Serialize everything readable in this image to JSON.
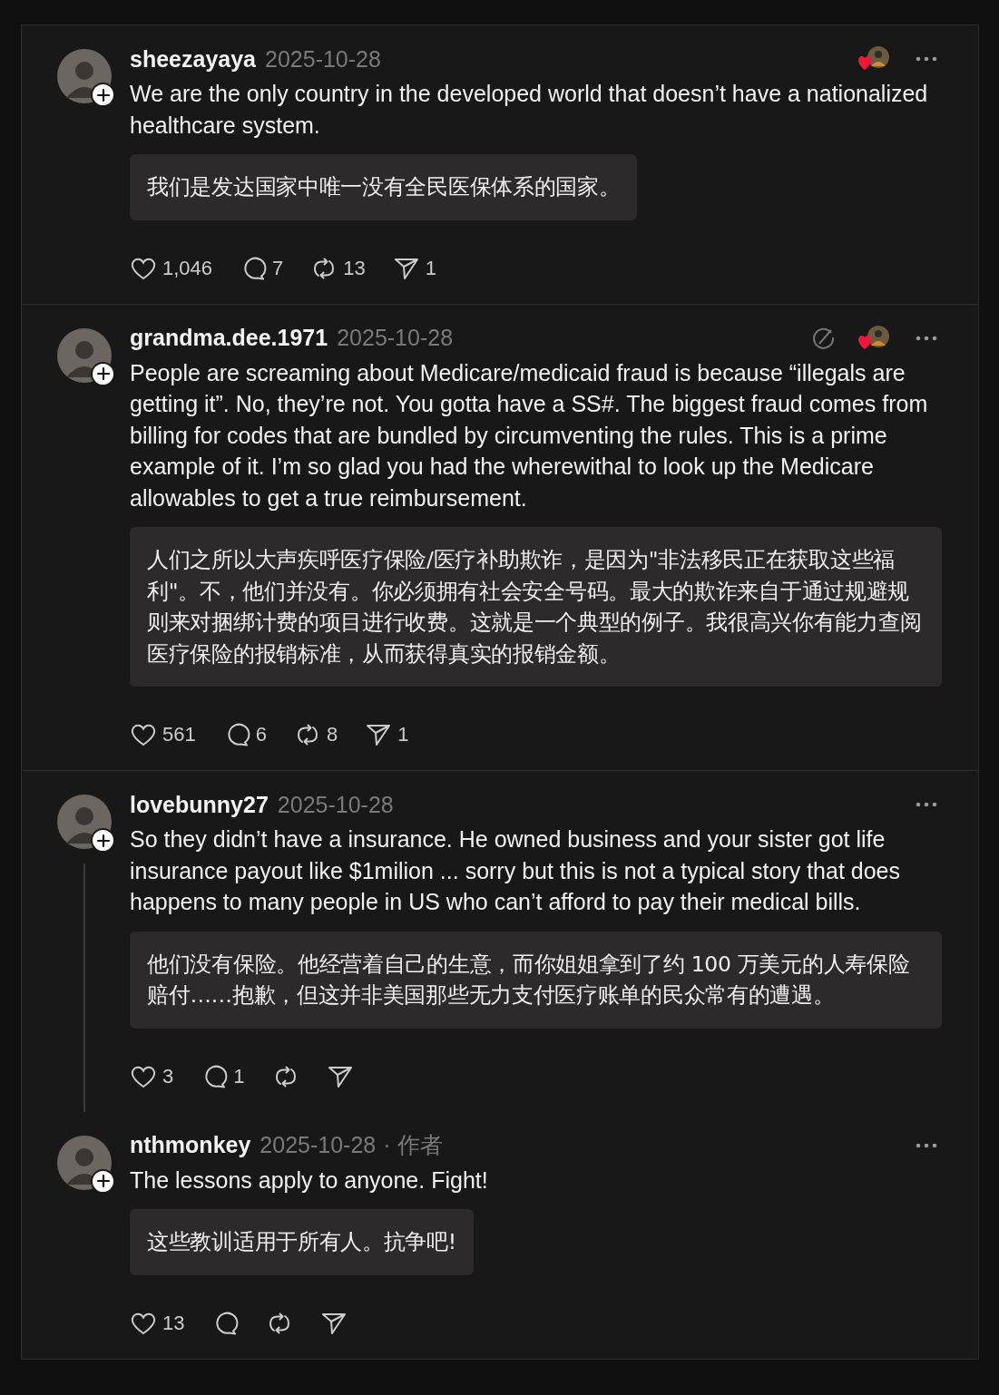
{
  "posts": [
    {
      "username": "sheezayaya",
      "date": "2025-10-28",
      "liked_by_author": true,
      "slash_icon": false,
      "thread_line": false,
      "text": "We are the only country in the developed world that doesn’t have a nationalized healthcare system.",
      "translation": "我们是发达国家中唯一没有全民医保体系的国家。",
      "actions": [
        {
          "kind": "like",
          "count": "1,046"
        },
        {
          "kind": "reply",
          "count": "7"
        },
        {
          "kind": "repost",
          "count": "13"
        },
        {
          "kind": "share",
          "count": "1"
        }
      ]
    },
    {
      "username": "grandma.dee.1971",
      "date": "2025-10-28",
      "liked_by_author": true,
      "slash_icon": true,
      "thread_line": false,
      "text": "People are screaming about Medicare/medicaid fraud is because “illegals are getting it”. No, they’re not. You gotta have a SS#. The biggest fraud comes from billing for codes that are bundled by circumventing the rules. This is a prime example of it. I’m so glad you had the wherewithal to look up the Medicare allowables to get a true reimbursement.",
      "translation": "人们之所以大声疾呼医疗保险/医疗补助欺诈，是因为\"非法移民正在获取这些福利\"。不，他们并没有。你必须拥有社会安全号码。最大的欺诈来自于通过规避规则来对捆绑计费的项目进行收费。这就是一个典型的例子。我很高兴你有能力查阅医疗保险的报销标准，从而获得真实的报销金额。",
      "actions": [
        {
          "kind": "like",
          "count": "561"
        },
        {
          "kind": "reply",
          "count": "6"
        },
        {
          "kind": "repost",
          "count": "8"
        },
        {
          "kind": "share",
          "count": "1"
        }
      ]
    },
    {
      "username": "lovebunny27",
      "date": "2025-10-28",
      "liked_by_author": false,
      "slash_icon": false,
      "thread_line": true,
      "text": "So they didn’t have a insurance. He owned business and your sister got life insurance payout like $1milion ... sorry but this is not a typical story that does happens to many people in US who can’t afford to pay their medical bills.",
      "translation": "他们没有保险。他经营着自己的生意，而你姐姐拿到了约 100 万美元的人寿保险赔付……抱歉，但这并非美国那些无力支付医疗账单的民众常有的遭遇。",
      "actions": [
        {
          "kind": "like",
          "count": "3"
        },
        {
          "kind": "reply",
          "count": "1"
        },
        {
          "kind": "repost"
        },
        {
          "kind": "share"
        }
      ]
    },
    {
      "username": "nthmonkey",
      "date": "2025-10-28",
      "author_tag": "· 作者",
      "liked_by_author": false,
      "slash_icon": false,
      "thread_line": false,
      "text": "The lessons apply to anyone. Fight!",
      "translation": "这些教训适用于所有人。抗争吧!",
      "actions": [
        {
          "kind": "like",
          "count": "13"
        },
        {
          "kind": "reply"
        },
        {
          "kind": "repost"
        },
        {
          "kind": "share"
        }
      ]
    }
  ]
}
